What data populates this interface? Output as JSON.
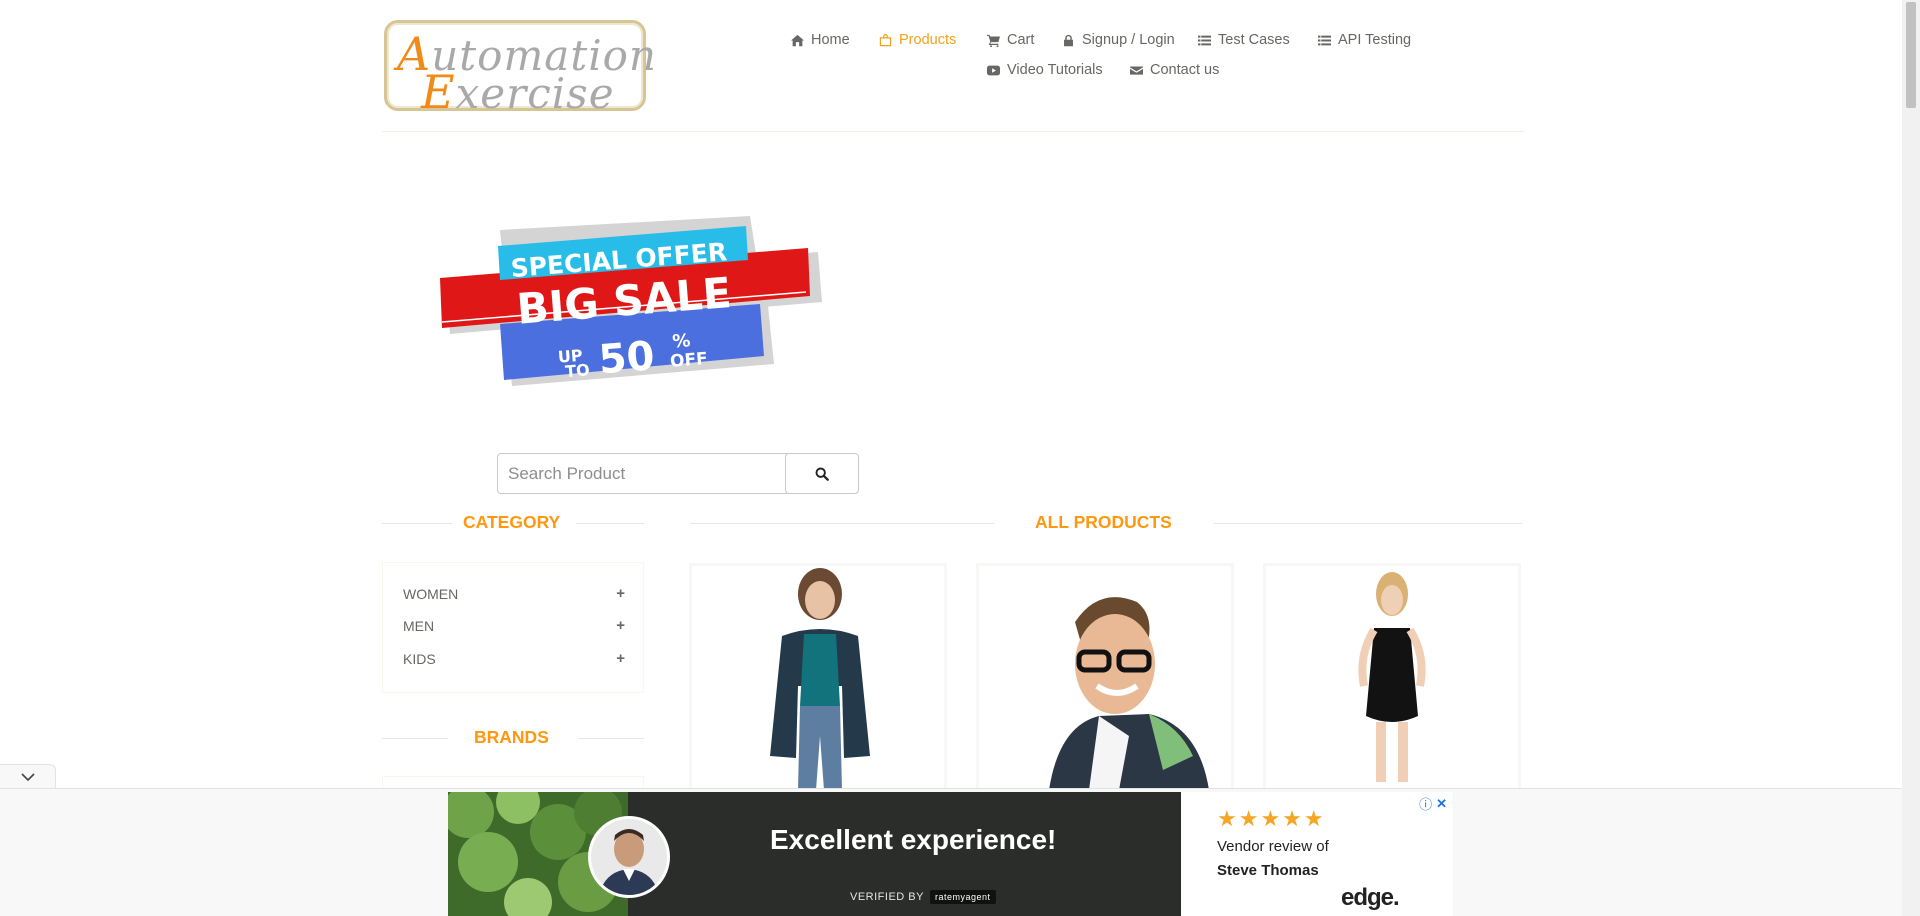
{
  "logo": {
    "line1_cap": "A",
    "line1_rest": "utomation",
    "line2_cap": "E",
    "line2_rest": "xercise"
  },
  "nav": {
    "items": [
      {
        "label": "Home",
        "icon": "home-icon"
      },
      {
        "label": "Products",
        "icon": "shopping-bag-icon",
        "active": true
      },
      {
        "label": "Cart",
        "icon": "shopping-cart-icon"
      },
      {
        "label": "Signup / Login",
        "icon": "lock-icon"
      },
      {
        "label": "Test Cases",
        "icon": "list-icon"
      },
      {
        "label": "API Testing",
        "icon": "list-icon"
      },
      {
        "label": "Video Tutorials",
        "icon": "youtube-play-icon"
      },
      {
        "label": "Contact us",
        "icon": "envelope-icon"
      }
    ]
  },
  "banner": {
    "top": "SPECIAL OFFER",
    "middle": "BIG SALE",
    "up": "UP",
    "to": "TO",
    "number": "50",
    "percent": "%",
    "off": "OFF"
  },
  "search": {
    "placeholder": "Search Product",
    "value": ""
  },
  "sidebar": {
    "category_title": "Category",
    "categories": [
      {
        "label": "WOMEN",
        "toggle": "+"
      },
      {
        "label": "MEN",
        "toggle": "+"
      },
      {
        "label": "KIDS",
        "toggle": "+"
      }
    ],
    "brands_title": "Brands"
  },
  "products": {
    "title": "All Products"
  },
  "ad": {
    "headline": "Excellent experience!",
    "verified_by": "VERIFIED BY",
    "verifier": "ratemyagent",
    "stars": "★★★★★",
    "vendor_line1": "Vendor review of",
    "vendor_line2": "Steve Thomas",
    "brand": "edge.",
    "info": "ⓘ",
    "close": "✕"
  },
  "colors": {
    "accent": "#fe980f",
    "nav_active": "#f0a31b",
    "text": "#696763"
  }
}
